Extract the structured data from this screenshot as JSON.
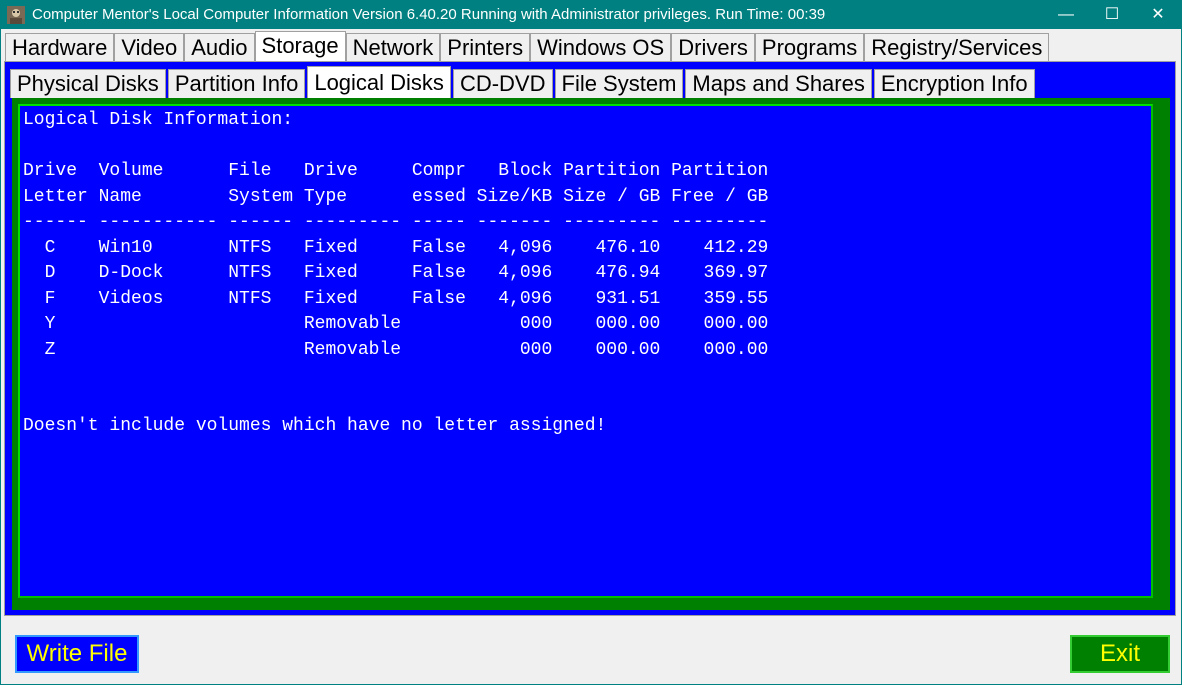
{
  "window": {
    "title": "Computer Mentor's Local Computer Information Version 6.40.20 Running with Administrator privileges.  Run Time: 00:39",
    "min_glyph": "—",
    "max_glyph": "☐",
    "close_glyph": "✕"
  },
  "top_tabs": [
    {
      "label": "Hardware",
      "active": false
    },
    {
      "label": "Video",
      "active": false
    },
    {
      "label": "Audio",
      "active": false
    },
    {
      "label": "Storage",
      "active": true
    },
    {
      "label": "Network",
      "active": false
    },
    {
      "label": "Printers",
      "active": false
    },
    {
      "label": "Windows OS",
      "active": false
    },
    {
      "label": "Drivers",
      "active": false
    },
    {
      "label": "Programs",
      "active": false
    },
    {
      "label": "Registry/Services",
      "active": false
    }
  ],
  "sub_tabs": [
    {
      "label": "Physical Disks",
      "active": false
    },
    {
      "label": "Partition Info",
      "active": false
    },
    {
      "label": "Logical Disks",
      "active": true
    },
    {
      "label": "CD-DVD",
      "active": false
    },
    {
      "label": "File System",
      "active": false
    },
    {
      "label": "Maps and Shares",
      "active": false
    },
    {
      "label": "Encryption Info",
      "active": false
    }
  ],
  "console": {
    "heading": "Logical Disk Information:",
    "header_row_1": [
      "Drive",
      "Volume",
      "File",
      "Drive",
      "Compr",
      "Block",
      "Partition",
      "Partition"
    ],
    "header_row_2": [
      "Letter",
      "Name",
      "System",
      "Type",
      "essed",
      "Size/KB",
      "Size / GB",
      "Free / GB"
    ],
    "separator": "------ ----------- ------ --------- ----- ------- --------- ---------",
    "rows": [
      {
        "letter": "C",
        "name": "Win10",
        "fs": "NTFS",
        "type": "Fixed",
        "compressed": "False",
        "block": "4,096",
        "size": "476.10",
        "free": "412.29"
      },
      {
        "letter": "D",
        "name": "D-Dock",
        "fs": "NTFS",
        "type": "Fixed",
        "compressed": "False",
        "block": "4,096",
        "size": "476.94",
        "free": "369.97"
      },
      {
        "letter": "F",
        "name": "Videos",
        "fs": "NTFS",
        "type": "Fixed",
        "compressed": "False",
        "block": "4,096",
        "size": "931.51",
        "free": "359.55"
      },
      {
        "letter": "Y",
        "name": "",
        "fs": "",
        "type": "Removable",
        "compressed": "",
        "block": "000",
        "size": "000.00",
        "free": "000.00"
      },
      {
        "letter": "Z",
        "name": "",
        "fs": "",
        "type": "Removable",
        "compressed": "",
        "block": "000",
        "size": "000.00",
        "free": "000.00"
      }
    ],
    "note": "Doesn't include volumes which have no letter assigned!"
  },
  "buttons": {
    "write_file": "Write File",
    "exit": "Exit"
  },
  "colors": {
    "title_bar": "#008080",
    "console_bg": "#0000ff",
    "console_text": "#ffffff",
    "frame": "#008000",
    "button_text": "#ffff00"
  }
}
